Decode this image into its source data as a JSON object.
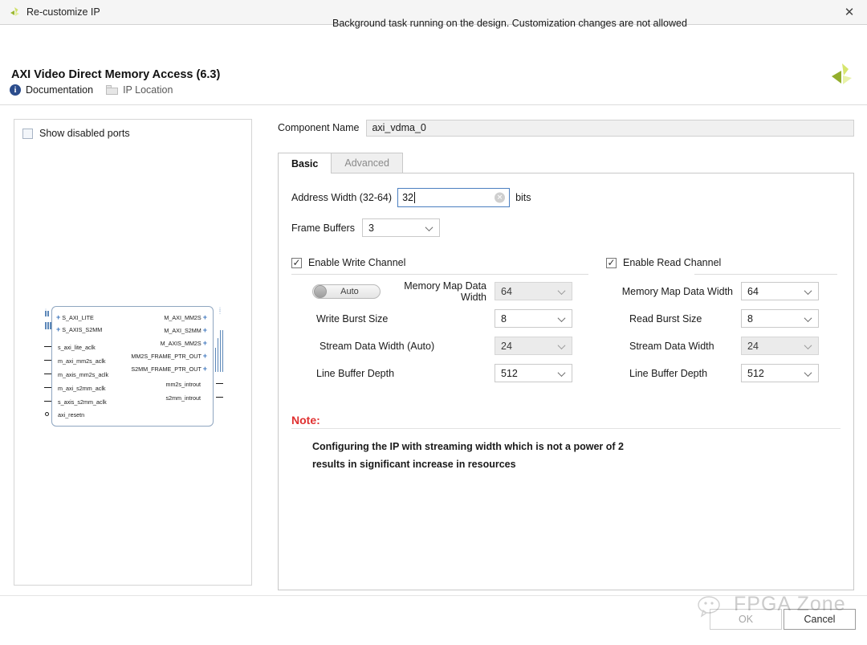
{
  "window": {
    "title": "Re-customize IP",
    "close_icon": "close-icon",
    "app_icon": "xilinx-logo-icon"
  },
  "header": {
    "title": "AXI Video Direct Memory Access (6.3)",
    "logo_icon": "xilinx-logo-icon",
    "toolbar": [
      {
        "label": "Documentation",
        "icon": "info-icon",
        "enabled": true
      },
      {
        "label": "IP Location",
        "icon": "folder-icon",
        "enabled": false
      }
    ]
  },
  "left_panel": {
    "show_disabled_ports": {
      "label": "Show disabled ports",
      "checked": false
    },
    "diagram": {
      "left_ports": [
        "S_AXI_LITE",
        "S_AXIS_S2MM",
        "s_axi_lite_aclk",
        "m_axi_mm2s_aclk",
        "m_axis_mm2s_aclk",
        "m_axi_s2mm_aclk",
        "s_axis_s2mm_aclk",
        "axi_resetn"
      ],
      "right_ports": [
        "M_AXI_MM2S",
        "M_AXI_S2MM",
        "M_AXIS_MM2S",
        "MM2S_FRAME_PTR_OUT",
        "S2MM_FRAME_PTR_OUT",
        "mm2s_introut",
        "s2mm_introut"
      ]
    }
  },
  "form": {
    "component_name_label": "Component Name",
    "component_name_value": "axi_vdma_0",
    "tabs": [
      {
        "label": "Basic",
        "active": true
      },
      {
        "label": "Advanced",
        "active": false
      }
    ],
    "address_width": {
      "label": "Address Width (32-64)",
      "value": "32",
      "units": "bits",
      "clear_icon": "clear-icon"
    },
    "frame_buffers": {
      "label": "Frame Buffers",
      "value": "3"
    },
    "write_channel": {
      "checkbox_label": "Enable Write Channel",
      "checked": true,
      "auto_toggle": {
        "label": "Auto",
        "on": false
      },
      "fields": [
        {
          "label": "Memory Map Data Width",
          "value": "64",
          "disabled": true
        },
        {
          "label": "Write Burst Size",
          "value": "8",
          "disabled": false
        },
        {
          "label": "Stream Data Width (Auto)",
          "value": "24",
          "disabled": true
        },
        {
          "label": "Line Buffer Depth",
          "value": "512",
          "disabled": false
        }
      ]
    },
    "read_channel": {
      "checkbox_label": "Enable Read Channel",
      "checked": true,
      "fields": [
        {
          "label": "Memory Map Data Width",
          "value": "64",
          "disabled": false
        },
        {
          "label": "Read Burst Size",
          "value": "8",
          "disabled": false
        },
        {
          "label": "Stream Data Width",
          "value": "24",
          "disabled": true
        },
        {
          "label": "Line Buffer Depth",
          "value": "512",
          "disabled": false
        }
      ]
    },
    "note": {
      "title": "Note:",
      "line1": "Configuring the IP with streaming width which is not a power of 2",
      "line2": "results in significant increase in resources"
    }
  },
  "footer": {
    "status": "Background task running on the design. Customization changes are not allowed",
    "ok_label": "OK",
    "cancel_label": "Cancel"
  },
  "watermark": {
    "text": "FPGA Zone",
    "icon": "wechat-icon"
  },
  "colors": {
    "accent_blue": "#4178be",
    "note_red": "#e03030",
    "focus_border": "#4b7fc0",
    "logo_green": "#b6d236"
  }
}
